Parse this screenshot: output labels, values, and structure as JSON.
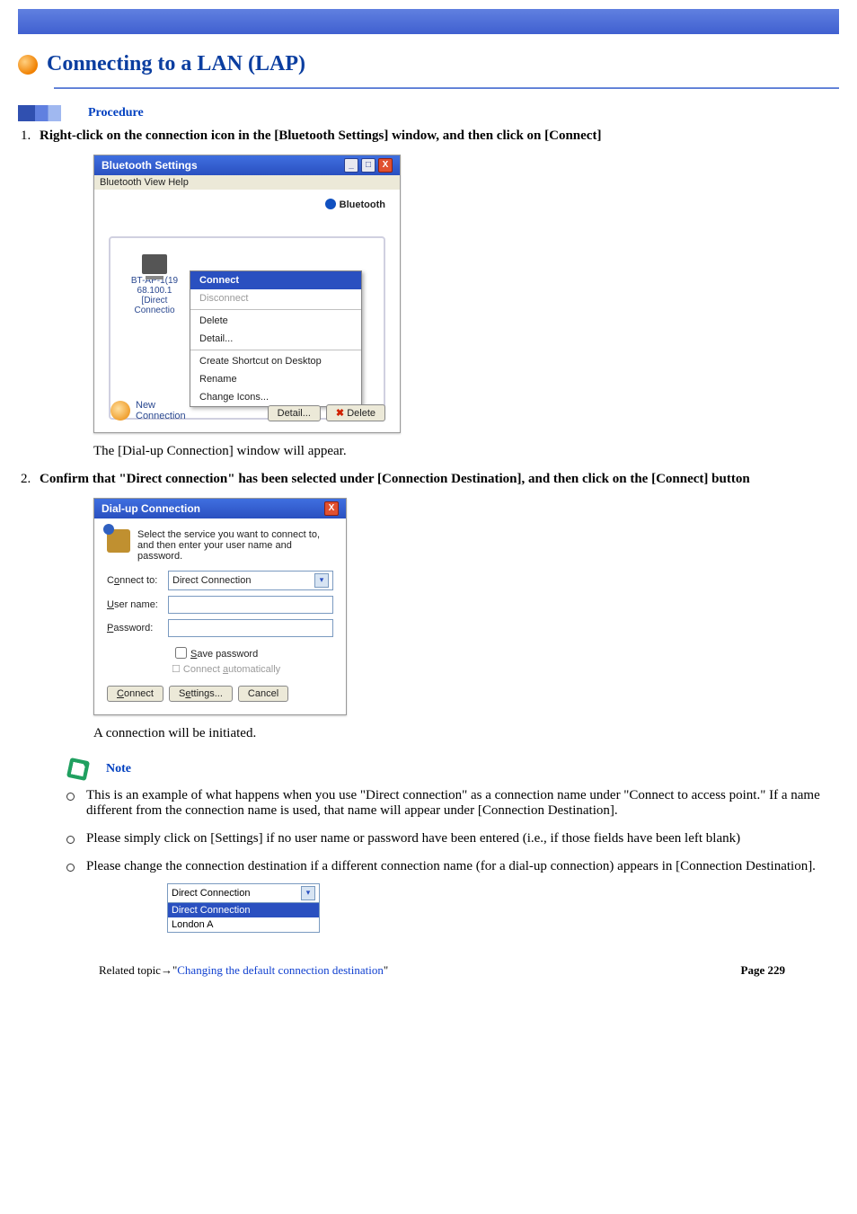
{
  "header": {
    "title": "Connecting to a LAN (LAP)"
  },
  "procedure": {
    "label": "Procedure"
  },
  "steps": [
    {
      "text": "Right-click on the connection icon in the [Bluetooth Settings] window, and then click on [Connect]",
      "after": "The [Dial-up Connection] window will appear."
    },
    {
      "text": "Confirm that \"Direct connection\" has been selected under [Connection Destination], and then click on the [Connect] button",
      "after": "A connection will be initiated."
    }
  ],
  "note": {
    "label": "Note"
  },
  "notes": [
    "This is an example of what happens when you use \"Direct connection\" as a connection name under \"Connect to access point.\" If a name different from the connection name is used, that name will appear under [Connection Destination].",
    "Please simply click on [Settings] if no user name or password have been entered (i.e., if those fields have been left blank)",
    "Please change the connection destination if a different connection name (for a dial-up connection) appears in [Connection Destination]."
  ],
  "bt": {
    "title": "Bluetooth Settings",
    "menu": "Bluetooth   View   Help",
    "badge": "Bluetooth",
    "device": "BT-AP-1(19\n68.100.1\n[Direct\nConnectio",
    "ctx": {
      "connect": "Connect",
      "disconnect": "Disconnect",
      "delete": "Delete",
      "detail": "Detail...",
      "shortcut": "Create Shortcut on Desktop",
      "rename": "Rename",
      "icons": "Change Icons..."
    },
    "newconn": "New\nConnection",
    "btn_detail": "Detail...",
    "btn_delete": "Delete"
  },
  "du": {
    "title": "Dial-up Connection",
    "desc": "Select the service you want to connect to, and then enter your user name and password.",
    "l_connect": "Connect to:",
    "v_connect": "Direct Connection",
    "l_user": "User name:",
    "l_pass": "Password:",
    "save": "Save password",
    "auto": "Connect automatically",
    "b_connect": "Connect",
    "b_settings": "Settings...",
    "b_cancel": "Cancel"
  },
  "combo": {
    "sel": "Direct Connection",
    "opt1": "Direct Connection",
    "opt2": "London A"
  },
  "footer": {
    "related_prefix": "Related topic→\"",
    "related_link": "Changing the default connection destination",
    "related_suffix": "\"",
    "page": "Page  229"
  }
}
